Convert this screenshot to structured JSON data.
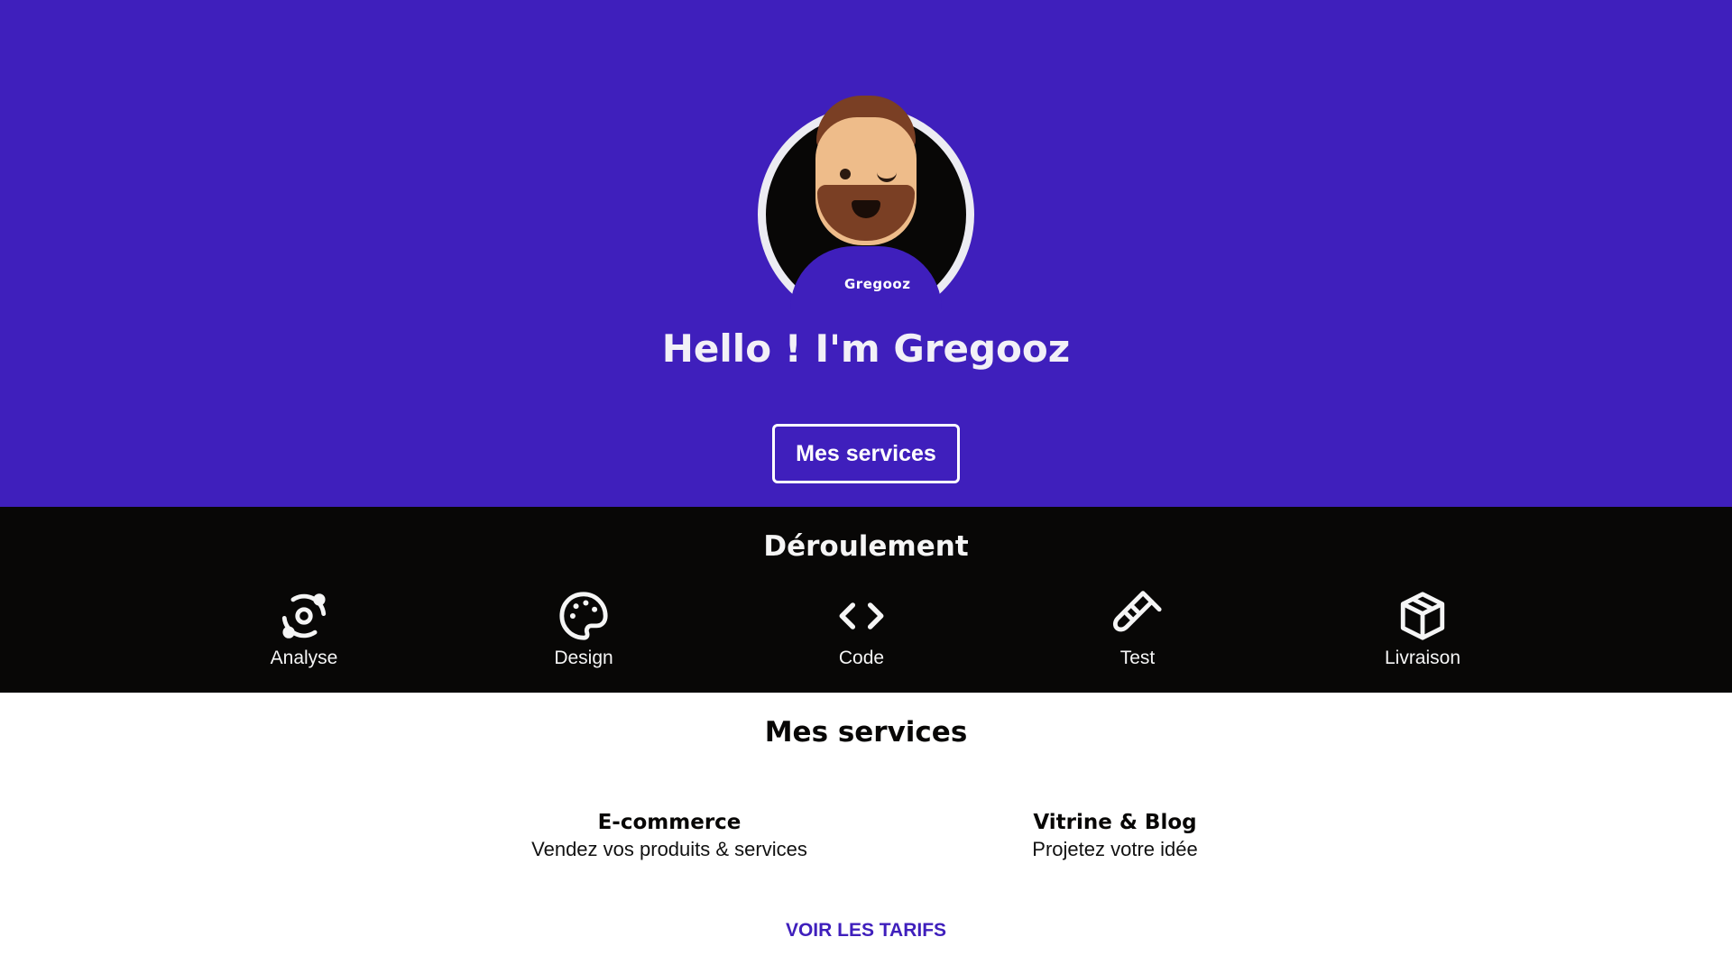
{
  "hero": {
    "avatar_brand": "Gregooz",
    "title": "Hello ! I'm Gregooz",
    "button_label": "Mes services",
    "background": "#3f1fbc"
  },
  "process": {
    "title": "Déroulement",
    "steps": [
      {
        "label": "Analyse",
        "icon": "analysis-icon"
      },
      {
        "label": "Design",
        "icon": "palette-icon"
      },
      {
        "label": "Code",
        "icon": "code-icon"
      },
      {
        "label": "Test",
        "icon": "test-tube-icon"
      },
      {
        "label": "Livraison",
        "icon": "package-icon"
      }
    ]
  },
  "services": {
    "title": "Mes services",
    "items": [
      {
        "name": "E-commerce",
        "description": "Vendez vos produits & services"
      },
      {
        "name": "Vitrine & Blog",
        "description": "Projetez votre idée"
      }
    ],
    "pricing_link": "VOIR LES TARIFS"
  },
  "colors": {
    "accent": "#3f1fbc",
    "dark": "#080706",
    "light": "#ffffff"
  }
}
